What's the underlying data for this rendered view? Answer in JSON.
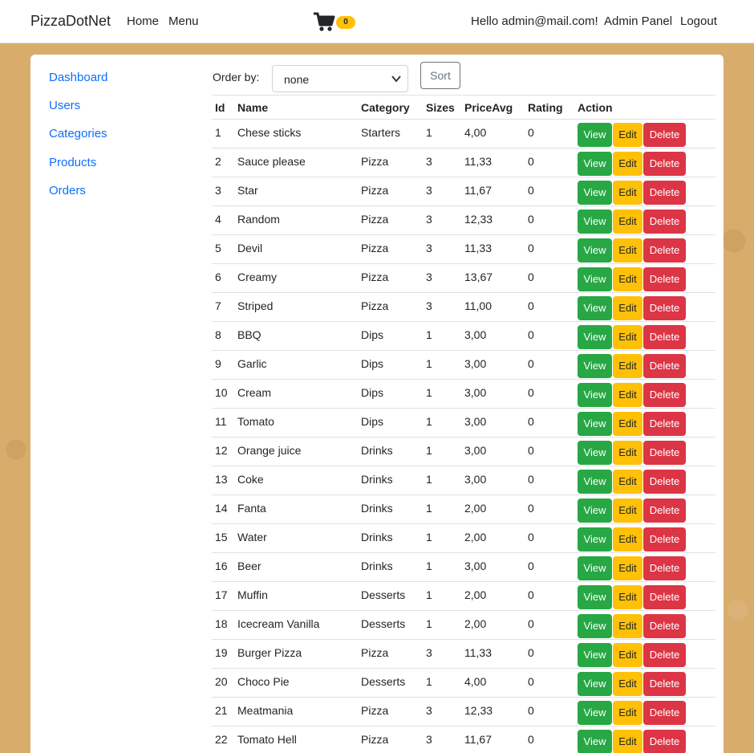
{
  "navbar": {
    "brand": "PizzaDotNet",
    "home": "Home",
    "menu": "Menu",
    "cart_count": "0",
    "greeting": "Hello admin@mail.com!",
    "admin_panel": "Admin Panel",
    "logout": "Logout"
  },
  "sidebar": {
    "items": [
      {
        "label": "Dashboard"
      },
      {
        "label": "Users"
      },
      {
        "label": "Categories"
      },
      {
        "label": "Products"
      },
      {
        "label": "Orders"
      }
    ]
  },
  "toolbar": {
    "order_by_label": "Order by:",
    "order_by_value": "none",
    "sort_label": "Sort"
  },
  "table": {
    "headers": [
      "Id",
      "Name",
      "Category",
      "Sizes",
      "PriceAvg",
      "Rating",
      "Action"
    ],
    "action_labels": {
      "view": "View",
      "edit": "Edit",
      "delete": "Delete"
    },
    "rows": [
      [
        "1",
        "Chese sticks",
        "Starters",
        "1",
        "4,00",
        "0"
      ],
      [
        "2",
        "Sauce please",
        "Pizza",
        "3",
        "11,33",
        "0"
      ],
      [
        "3",
        "Star",
        "Pizza",
        "3",
        "11,67",
        "0"
      ],
      [
        "4",
        "Random",
        "Pizza",
        "3",
        "12,33",
        "0"
      ],
      [
        "5",
        "Devil",
        "Pizza",
        "3",
        "11,33",
        "0"
      ],
      [
        "6",
        "Creamy",
        "Pizza",
        "3",
        "13,67",
        "0"
      ],
      [
        "7",
        "Striped",
        "Pizza",
        "3",
        "11,00",
        "0"
      ],
      [
        "8",
        "BBQ",
        "Dips",
        "1",
        "3,00",
        "0"
      ],
      [
        "9",
        "Garlic",
        "Dips",
        "1",
        "3,00",
        "0"
      ],
      [
        "10",
        "Cream",
        "Dips",
        "1",
        "3,00",
        "0"
      ],
      [
        "11",
        "Tomato",
        "Dips",
        "1",
        "3,00",
        "0"
      ],
      [
        "12",
        "Orange juice",
        "Drinks",
        "1",
        "3,00",
        "0"
      ],
      [
        "13",
        "Coke",
        "Drinks",
        "1",
        "3,00",
        "0"
      ],
      [
        "14",
        "Fanta",
        "Drinks",
        "1",
        "2,00",
        "0"
      ],
      [
        "15",
        "Water",
        "Drinks",
        "1",
        "2,00",
        "0"
      ],
      [
        "16",
        "Beer",
        "Drinks",
        "1",
        "3,00",
        "0"
      ],
      [
        "17",
        "Muffin",
        "Desserts",
        "1",
        "2,00",
        "0"
      ],
      [
        "18",
        "Icecream Vanilla",
        "Desserts",
        "1",
        "2,00",
        "0"
      ],
      [
        "19",
        "Burger Pizza",
        "Pizza",
        "3",
        "11,33",
        "0"
      ],
      [
        "20",
        "Choco Pie",
        "Desserts",
        "1",
        "4,00",
        "0"
      ],
      [
        "21",
        "Meatmania",
        "Pizza",
        "3",
        "12,33",
        "0"
      ],
      [
        "22",
        "Tomato Hell",
        "Pizza",
        "3",
        "11,67",
        "0"
      ]
    ]
  }
}
